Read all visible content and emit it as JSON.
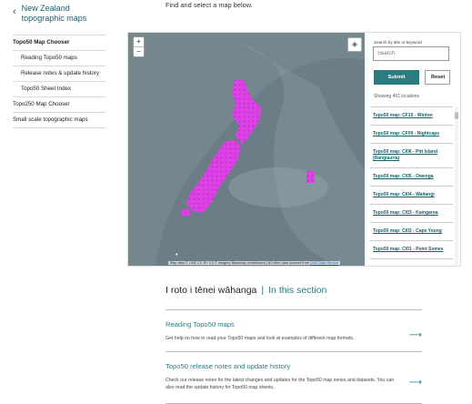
{
  "back": {
    "label": "New Zealand topographic maps"
  },
  "intro": "Find and select a map below.",
  "sidebar": {
    "items": [
      {
        "label": "Topo50 Map Chooser"
      },
      {
        "label": "Reading Topo50 maps"
      },
      {
        "label": "Release notes & update history"
      },
      {
        "label": "Topo50 Sheet Index"
      },
      {
        "label": "Topo250 Map Chooser"
      },
      {
        "label": "Small scale topographic maps"
      }
    ]
  },
  "map": {
    "zoom_in": "+",
    "zoom_out": "−",
    "attribution": "Map data © LINZ CC BY 4.0 © Imagery Basemap contributors | All other data sourced from",
    "attribution_link": "LINZ Data Service"
  },
  "search": {
    "label": "Search by title or keyword",
    "placeholder": "Search",
    "submit": "Submit",
    "reset": "Reset",
    "showing": "Showing 451 locations",
    "results": [
      "Topo50 map: CF10 - Winton",
      "Topo50 map: CF09 - Nightcaps",
      "Topo50 map: CI06 - Pitt Island (Rangiauria)",
      "Topo50 map: CI05 - Owenga",
      "Topo50 map: CI04 - Waitangi",
      "Topo50 map: CI03 - Kaingaroa",
      "Topo50 map: CI02 - Cape Young",
      "Topo50 map: CI01 - Point Somes"
    ]
  },
  "section": {
    "heading": "I roto i tēnei wāhanga",
    "sub": "In this section",
    "cards": [
      {
        "title": "Reading Topo50 maps",
        "desc": "Get help on how to read your Topo50 maps and look at examples of different map formats."
      },
      {
        "title": "Topo50 release notes and update history",
        "desc": "Check our release notes for the latest changes and updates for the Topo50 map series and datasets. You can also read the update history for Topo50 map sheets."
      }
    ]
  },
  "colors": {
    "accent": "#2b7b7f",
    "link": "#17606e",
    "tiles": "#e040e8"
  }
}
